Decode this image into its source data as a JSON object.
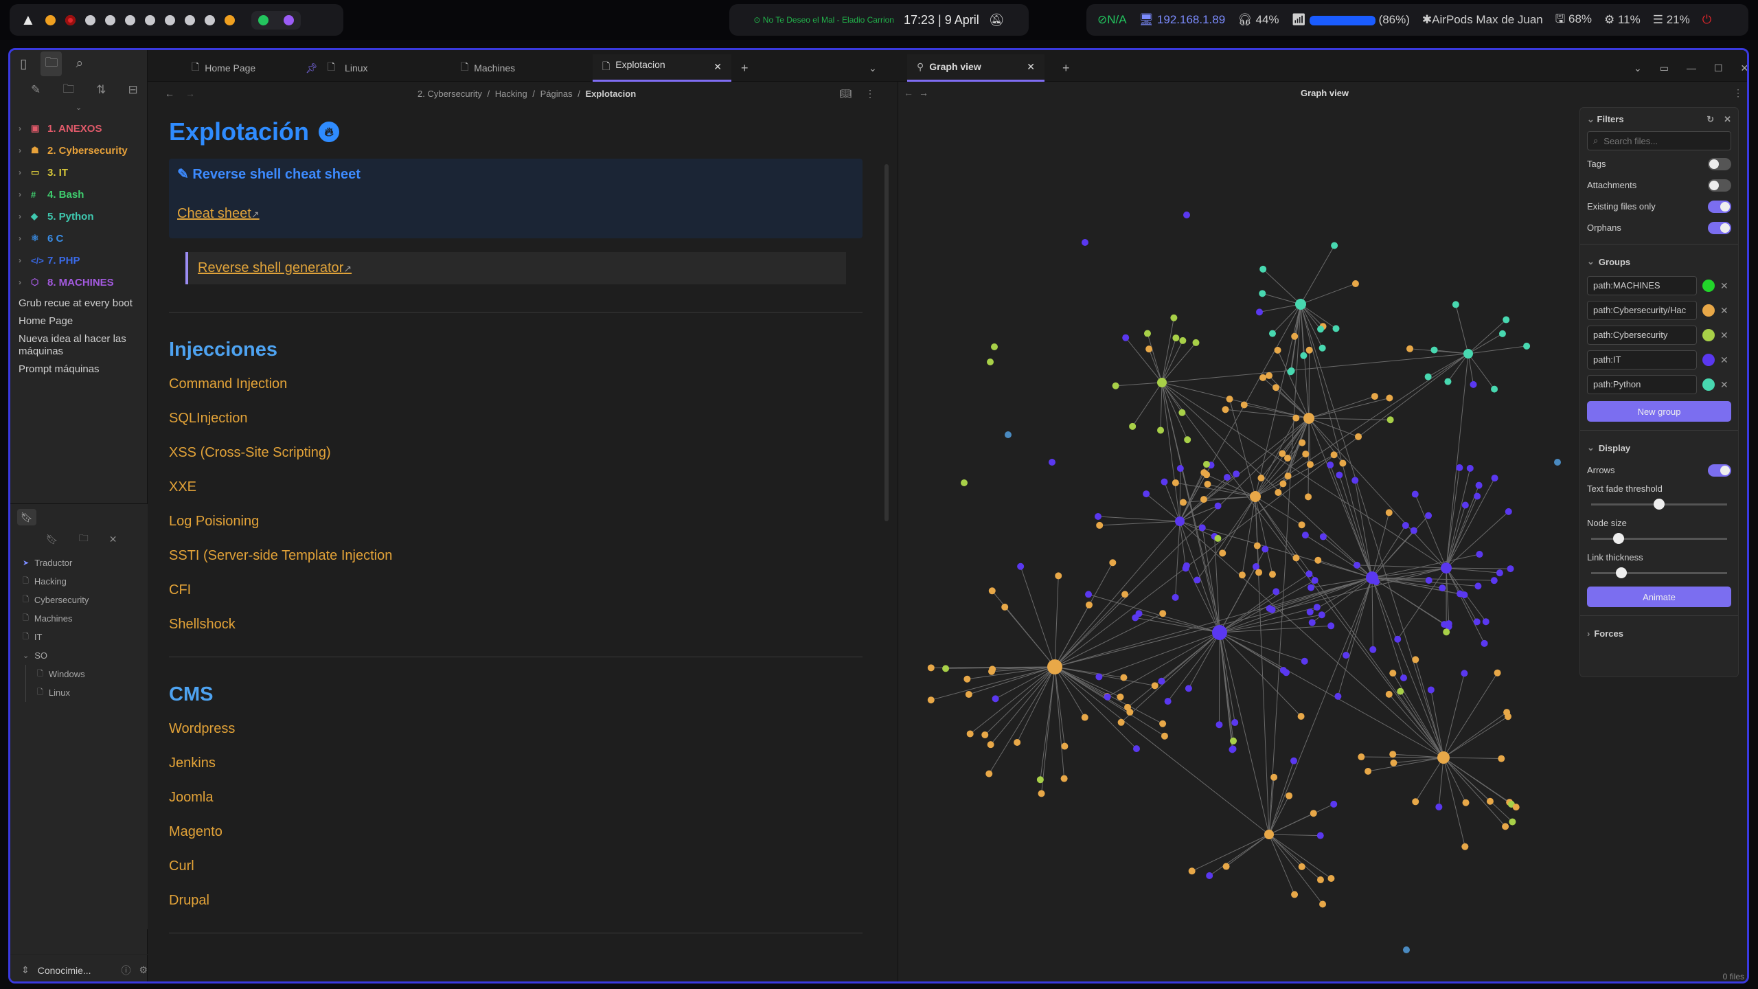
{
  "topbar": {
    "music": "No Te Deseo el Mal - Eladio Carrion",
    "time": "17:23 |  9 April",
    "vpn": "N/A",
    "ip": "192.168.1.89",
    "volume": "44%",
    "wifi": "(86%)",
    "bluetooth": "AirPods Max de Juan",
    "disk": "68%",
    "cpu": "11%",
    "mem": "21%",
    "colors": {
      "red": "#e0262b",
      "orange": "#f0a020",
      "green": "#23c55e",
      "purple": "#9b5cf6",
      "accent": "#3a3ae0"
    }
  },
  "sidebar": {
    "folders": [
      {
        "label": "1. ANEXOS",
        "color": "#e05a6a",
        "icon": "image-icon"
      },
      {
        "label": "2. Cybersecurity",
        "color": "#e8a23a",
        "icon": "people-icon"
      },
      {
        "label": "3. IT",
        "color": "#d8c83a",
        "icon": "monitor-icon"
      },
      {
        "label": "4. Bash",
        "color": "#3fcf6f",
        "icon": "hash-icon"
      },
      {
        "label": "5. Python",
        "color": "#3fc9b0",
        "icon": "python-icon"
      },
      {
        "label": "6 C",
        "color": "#3a8ee8",
        "icon": "atom-icon"
      },
      {
        "label": "7. PHP",
        "color": "#3a6ae8",
        "icon": "code-icon"
      },
      {
        "label": "8. MACHINES",
        "color": "#a45ae0",
        "icon": "box-icon"
      }
    ],
    "files": [
      "Grub recue at every boot",
      "Home Page",
      "Nueva idea al hacer las máquinas",
      "Prompt máquinas"
    ],
    "bookmarks_tree": [
      {
        "label": "Traductor",
        "indent": 0,
        "type": "app"
      },
      {
        "label": "Hacking",
        "indent": 0,
        "type": "file"
      },
      {
        "label": "Cybersecurity",
        "indent": 0,
        "type": "file"
      },
      {
        "label": "Machines",
        "indent": 0,
        "type": "file"
      },
      {
        "label": "IT",
        "indent": 0,
        "type": "file"
      },
      {
        "label": "SO",
        "indent": 0,
        "type": "folder"
      },
      {
        "label": "Windows",
        "indent": 1,
        "type": "file"
      },
      {
        "label": "Linux",
        "indent": 1,
        "type": "file"
      }
    ],
    "vault": "Conocimie..."
  },
  "tabs": [
    {
      "label": "Home Page",
      "active": false
    },
    {
      "label": "Linux",
      "active": false
    },
    {
      "label": "Machines",
      "active": false
    },
    {
      "label": "Explotacion",
      "active": true
    }
  ],
  "right_tab": {
    "label": "Graph view"
  },
  "breadcrumb": [
    "2. Cybersecurity",
    "/",
    "Hacking",
    "/",
    "Páginas",
    "/",
    "Explotacion"
  ],
  "note": {
    "title": "Explotación",
    "callout_title": "Reverse shell cheat sheet",
    "callout_link": "Cheat sheet",
    "quote_link": "Reverse shell generator",
    "sections": [
      {
        "heading": "Injecciones",
        "items": [
          "Command Injection",
          "SQLInjection",
          "XSS (Cross-Site Scripting)",
          "XXE",
          "Log Poisioning",
          "SSTI (Server-side Template Injection",
          "CFI",
          "Shellshock"
        ]
      },
      {
        "heading": "CMS",
        "items": [
          "Wordpress",
          "Jenkins",
          "Joomla",
          "Magento",
          "Curl",
          "Drupal"
        ]
      }
    ]
  },
  "graph": {
    "title": "Graph view",
    "files_count": "0 files",
    "filters": {
      "heading": "Filters",
      "search_placeholder": "Search files...",
      "toggles": [
        {
          "label": "Tags",
          "on": false
        },
        {
          "label": "Attachments",
          "on": false
        },
        {
          "label": "Existing files only",
          "on": true
        },
        {
          "label": "Orphans",
          "on": true
        }
      ]
    },
    "groups": {
      "heading": "Groups",
      "items": [
        {
          "query": "path:MACHINES",
          "color": "#22d52a"
        },
        {
          "query": "path:Cybersecurity/Hac",
          "color": "#e8a848"
        },
        {
          "query": "path:Cybersecurity",
          "color": "#a8d048"
        },
        {
          "query": "path:IT",
          "color": "#5a38f0"
        },
        {
          "query": "path:Python",
          "color": "#48d8b0"
        }
      ],
      "new_group": "New group"
    },
    "display": {
      "heading": "Display",
      "arrows_label": "Arrows",
      "arrows_on": true,
      "sliders": [
        {
          "label": "Text fade threshold",
          "value": 0.5
        },
        {
          "label": "Node size",
          "value": 0.2
        },
        {
          "label": "Link thickness",
          "value": 0.22
        }
      ],
      "animate": "Animate"
    },
    "forces": "Forces",
    "colors": {
      "orange": "#e8a848",
      "purple": "#5a38f0",
      "lime": "#a8d048",
      "teal": "#48d8b0",
      "blue": "#4a8ac0"
    }
  }
}
